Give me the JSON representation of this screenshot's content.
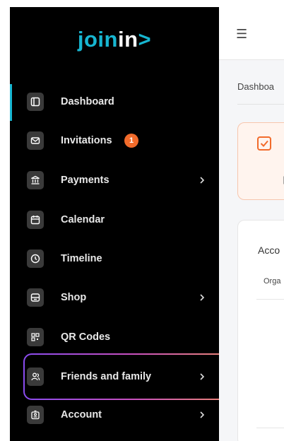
{
  "app": {
    "logo_part1": "join",
    "logo_part2": "in",
    "logo_part3": ">",
    "accent_color": "#17b6d1"
  },
  "sidebar": {
    "items": [
      {
        "label": "Dashboard",
        "icon": "dashboard-icon",
        "active": true
      },
      {
        "label": "Invitations",
        "icon": "envelope-icon",
        "badge": "1"
      },
      {
        "label": "Payments",
        "icon": "bank-icon",
        "has_chevron": true
      },
      {
        "label": "Calendar",
        "icon": "calendar-icon"
      },
      {
        "label": "Timeline",
        "icon": "clock-icon"
      },
      {
        "label": "Shop",
        "icon": "shop-icon",
        "has_chevron": true
      },
      {
        "label": "QR Codes",
        "icon": "qr-code-icon"
      },
      {
        "label": "Friends and family",
        "icon": "people-icon",
        "has_chevron": true,
        "highlighted": true
      },
      {
        "label": "Account",
        "icon": "account-icon",
        "has_chevron": true
      }
    ]
  },
  "header": {
    "menu_icon": "hamburger-icon"
  },
  "main": {
    "breadcrumb": "Dashboa",
    "account_card_title": "Acco",
    "account_card_column": "Orga"
  }
}
